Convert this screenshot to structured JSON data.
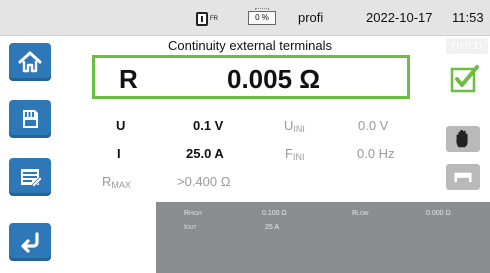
{
  "status_bar": {
    "network_sub": "FR",
    "battery": "0 %",
    "profile": "profi",
    "date": "2022-10-17",
    "time": "11:53"
  },
  "sidebar": {
    "items": [
      {
        "icon": "home-icon"
      },
      {
        "icon": "memory-card-icon"
      },
      {
        "icon": "report-icon"
      },
      {
        "icon": "back-arrow-icon"
      }
    ]
  },
  "main": {
    "title": "Continuity external terminals",
    "hold_label": "HOLD",
    "result": {
      "function": "R",
      "value": "0.005 Ω"
    },
    "status_icon": "checkmark-icon",
    "rows": [
      {
        "label": "U",
        "value": "0.1 V",
        "param_main": "U",
        "param_sub": "INI",
        "param_value": "0.0 V"
      },
      {
        "label": "I",
        "value": "25.0 A",
        "param_main": "F",
        "param_sub": "INI",
        "param_value": "0.0 Hz"
      },
      {
        "label_main": "R",
        "label_sub": "MAX",
        "value": ">0.400 Ω"
      }
    ],
    "tools": [
      {
        "icon": "hand-stop-icon"
      },
      {
        "icon": "probe-icon"
      }
    ],
    "info": {
      "rhigh_label": "R",
      "rhigh_sub": "HIGH",
      "rhigh_value": "0.100 Ω",
      "rlow_label": "R",
      "rlow_sub": "LOW",
      "rlow_value": "0.000 Ω",
      "iout_label": "I",
      "iout_sub": "OUT",
      "iout_value": "25 A"
    }
  },
  "colors": {
    "accent_blue": "#2f78b7",
    "ok_green": "#6dbd45",
    "panel_grey": "#8b8d91"
  }
}
